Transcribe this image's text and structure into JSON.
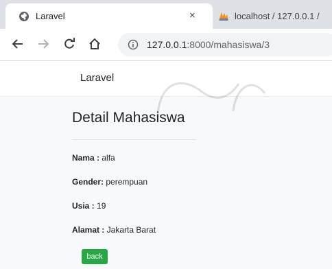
{
  "browser": {
    "tabs": [
      {
        "title": "Laravel",
        "favicon": "globe-icon",
        "active": true
      },
      {
        "title": "localhost / 127.0.0.1 /",
        "favicon": "phpmyadmin-icon",
        "active": false
      }
    ],
    "close_glyph": "×",
    "url": {
      "host": "127.0.0.1",
      "rest": ":8000/mahasiswa/3"
    }
  },
  "navbar": {
    "brand": "Laravel"
  },
  "page": {
    "heading": "Detail Mahasiswa",
    "fields": [
      {
        "label": "Nama :",
        "value": " alfa"
      },
      {
        "label": "Gender:",
        "value": " perempuan"
      },
      {
        "label": "Usia :",
        "value": " 19"
      },
      {
        "label": "Alamat :",
        "value": " Jakarta Barat"
      }
    ],
    "back_label": "back"
  },
  "colors": {
    "accent": "#28a745",
    "tabstrip": "#dee1e6",
    "page_bg": "#f8f9fa"
  }
}
